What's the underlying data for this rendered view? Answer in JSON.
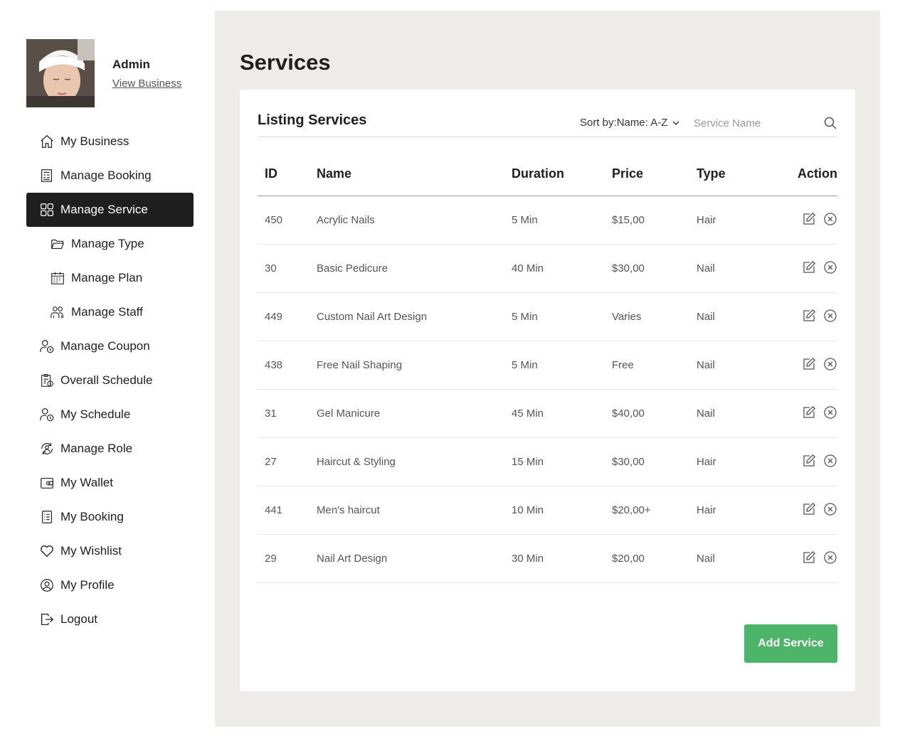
{
  "profile": {
    "name": "Admin",
    "view_business": "View Business"
  },
  "sidebar": {
    "items": [
      {
        "label": "My Business",
        "icon": "home-icon"
      },
      {
        "label": "Manage Booking",
        "icon": "booking-icon"
      },
      {
        "label": "Manage Service",
        "icon": "grid-icon",
        "active": true
      },
      {
        "label": "Manage Type",
        "icon": "folder-icon",
        "sub": true
      },
      {
        "label": "Manage Plan",
        "icon": "calendar-icon",
        "sub": true
      },
      {
        "label": "Manage Staff",
        "icon": "staff-icon",
        "sub": true
      },
      {
        "label": "Manage Coupon",
        "icon": "user-clock-icon"
      },
      {
        "label": "Overall Schedule",
        "icon": "schedule-icon"
      },
      {
        "label": "My Schedule",
        "icon": "user-clock-icon"
      },
      {
        "label": "Manage Role",
        "icon": "role-icon"
      },
      {
        "label": "My Wallet",
        "icon": "wallet-icon"
      },
      {
        "label": "My Booking",
        "icon": "list-icon"
      },
      {
        "label": "My Wishlist",
        "icon": "heart-icon"
      },
      {
        "label": "My Profile",
        "icon": "user-circle-icon"
      },
      {
        "label": "Logout",
        "icon": "logout-icon"
      }
    ]
  },
  "main": {
    "title": "Services",
    "listing_title": "Listing Services",
    "sort_label": "Sort by:",
    "sort_value": "Name: A-Z",
    "search_placeholder": "Service Name",
    "columns": [
      "ID",
      "Name",
      "Duration",
      "Price",
      "Type",
      "Action"
    ],
    "rows": [
      {
        "id": "450",
        "name": "Acrylic Nails",
        "duration": "5 Min",
        "price": "$15,00",
        "type": "Hair"
      },
      {
        "id": "30",
        "name": "Basic Pedicure",
        "duration": "40 Min",
        "price": "$30,00",
        "type": "Nail"
      },
      {
        "id": "449",
        "name": "Custom Nail Art Design",
        "duration": "5 Min",
        "price": "Varies",
        "type": "Nail"
      },
      {
        "id": "438",
        "name": "Free Nail Shaping",
        "duration": "5 Min",
        "price": "Free",
        "type": "Nail"
      },
      {
        "id": "31",
        "name": "Gel Manicure",
        "duration": "45 Min",
        "price": "$40,00",
        "type": "Nail"
      },
      {
        "id": "27",
        "name": "Haircut & Styling",
        "duration": "15 Min",
        "price": "$30,00",
        "type": "Hair"
      },
      {
        "id": "441",
        "name": "Men's haircut",
        "duration": "10 Min",
        "price": "$20,00+",
        "type": "Hair"
      },
      {
        "id": "29",
        "name": "Nail Art Design",
        "duration": "30 Min",
        "price": "$20,00",
        "type": "Nail"
      }
    ],
    "add_button": "Add Service"
  },
  "colors": {
    "active_bg": "#1f1f1f",
    "main_bg": "#eeece8",
    "accent_green": "#4db56a"
  }
}
